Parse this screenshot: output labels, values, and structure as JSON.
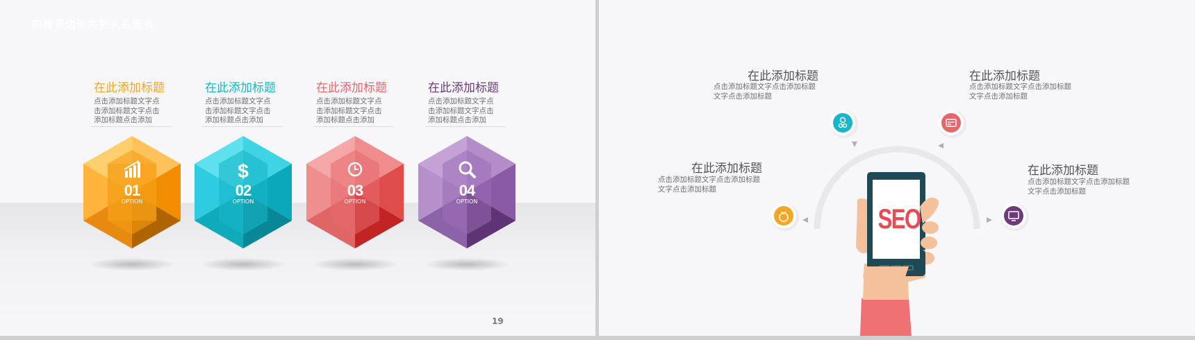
{
  "left_slide": {
    "deck_title": "四棱多边形并列关系图表",
    "page_number": "19",
    "cards": [
      {
        "title": "在此添加标题",
        "desc": "点击添加标题文字点击添加标题文字点击添加标题点击添加",
        "number": "01",
        "option": "OPTION",
        "color": "#f5a623",
        "icon": "bar-chart-icon"
      },
      {
        "title": "在此添加标题",
        "desc": "点击添加标题文字点击添加标题文字点击添加标题点击添加",
        "number": "02",
        "option": "OPTION",
        "color": "#17b6c8",
        "icon": "dollar-icon"
      },
      {
        "title": "在此添加标题",
        "desc": "点击添加标题文字点击添加标题文字点击添加标题点击添加",
        "number": "03",
        "option": "OPTION",
        "color": "#e5676b",
        "icon": "clock-icon"
      },
      {
        "title": "在此添加标题",
        "desc": "点击添加标题文字点击添加标题文字点击添加标题点击添加",
        "number": "04",
        "option": "OPTION",
        "color": "#6d3a7a",
        "icon": "search-icon"
      }
    ]
  },
  "right_slide": {
    "phone_text": "SEO",
    "items": [
      {
        "title": "在此添加标题",
        "desc1": "点击添加标题文字点击添加标题",
        "desc2": "文字点击添加标题",
        "icon": "people-icon",
        "color": "#17b6c8"
      },
      {
        "title": "在此添加标题",
        "desc1": "点击添加标题文字点击添加标题",
        "desc2": "文字点击添加标题",
        "icon": "card-icon",
        "color": "#e5676b"
      },
      {
        "title": "在此添加标题",
        "desc1": "点击添加标题文字点击添加标题",
        "desc2": "文字点击添加标题",
        "icon": "money-bag-icon",
        "color": "#f5a623"
      },
      {
        "title": "在此添加标题",
        "desc1": "点击添加标题文字点击添加标题",
        "desc2": "文字点击添加标题",
        "icon": "monitor-icon",
        "color": "#6d3a7a"
      }
    ]
  }
}
